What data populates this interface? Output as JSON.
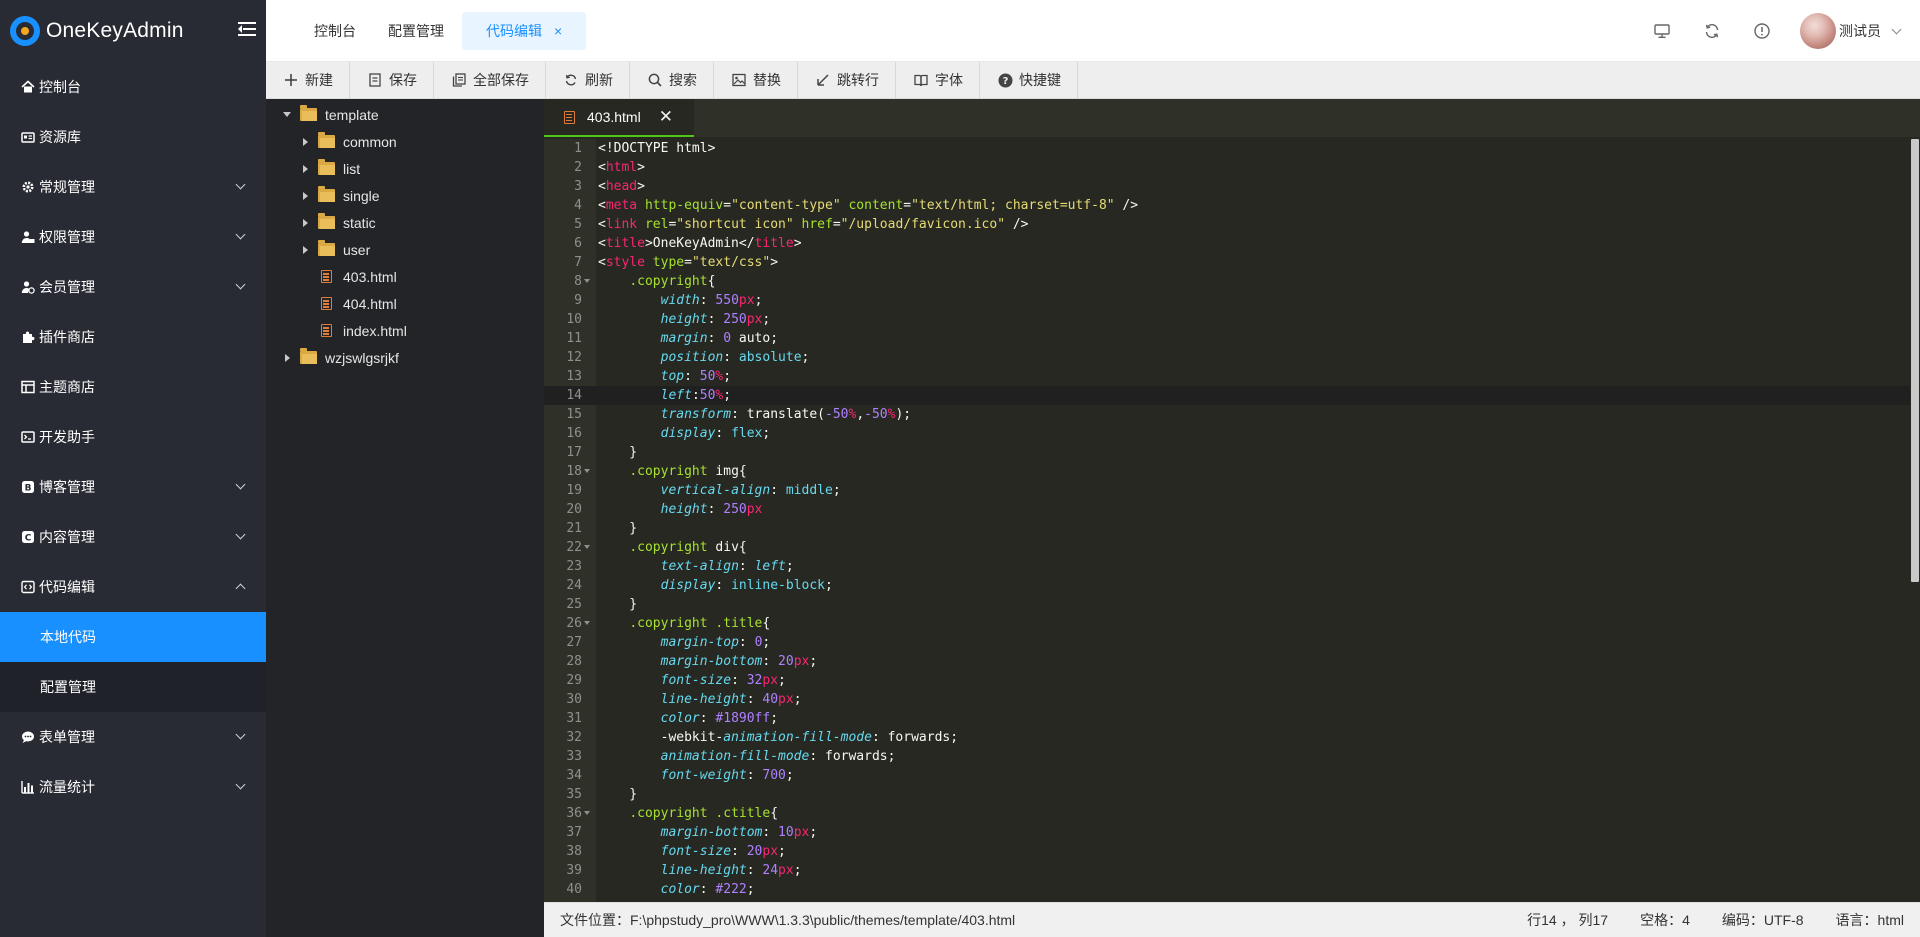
{
  "app": {
    "title": "OneKeyAdmin"
  },
  "sidebar": {
    "items": [
      {
        "label": "控制台",
        "icon": "home-icon"
      },
      {
        "label": "资源库",
        "icon": "library-icon"
      },
      {
        "label": "常规管理",
        "icon": "gear-icon",
        "expandable": true
      },
      {
        "label": "权限管理",
        "icon": "user-lock-icon",
        "expandable": true
      },
      {
        "label": "会员管理",
        "icon": "member-icon",
        "expandable": true
      },
      {
        "label": "插件商店",
        "icon": "puzzle-icon"
      },
      {
        "label": "主题商店",
        "icon": "layout-icon"
      },
      {
        "label": "开发助手",
        "icon": "terminal-icon"
      },
      {
        "label": "博客管理",
        "icon": "blog-icon",
        "expandable": true
      },
      {
        "label": "内容管理",
        "icon": "content-icon",
        "expandable": true
      },
      {
        "label": "代码编辑",
        "icon": "code-icon",
        "expandable": true,
        "expanded": true
      },
      {
        "label": "表单管理",
        "icon": "chat-icon",
        "expandable": true
      },
      {
        "label": "流量统计",
        "icon": "bar-chart-icon",
        "expandable": true
      }
    ],
    "code_submenu": [
      {
        "label": "本地代码",
        "active": true
      },
      {
        "label": "配置管理",
        "active": false
      }
    ]
  },
  "header": {
    "tabs": [
      {
        "label": "控制台"
      },
      {
        "label": "配置管理"
      },
      {
        "label": "代码编辑",
        "active": true,
        "close": "×"
      }
    ],
    "user": {
      "name": "测试员"
    }
  },
  "toolbar": {
    "buttons": [
      {
        "label": "新建",
        "icon": "plus-icon"
      },
      {
        "label": "保存",
        "icon": "save-icon"
      },
      {
        "label": "全部保存",
        "icon": "save-all-icon"
      },
      {
        "label": "刷新",
        "icon": "refresh-icon"
      },
      {
        "label": "搜索",
        "icon": "search-icon"
      },
      {
        "label": "替换",
        "icon": "replace-icon"
      },
      {
        "label": "跳转行",
        "icon": "goto-line-icon"
      },
      {
        "label": "字体",
        "icon": "font-icon"
      },
      {
        "label": "快捷键",
        "icon": "help-icon"
      }
    ]
  },
  "tree": {
    "nodes": [
      {
        "label": "template",
        "type": "folder",
        "open": true,
        "depth": 0
      },
      {
        "label": "common",
        "type": "folder",
        "open": false,
        "depth": 1
      },
      {
        "label": "list",
        "type": "folder",
        "open": false,
        "depth": 1
      },
      {
        "label": "single",
        "type": "folder",
        "open": false,
        "depth": 1
      },
      {
        "label": "static",
        "type": "folder",
        "open": false,
        "depth": 1
      },
      {
        "label": "user",
        "type": "folder",
        "open": false,
        "depth": 1
      },
      {
        "label": "403.html",
        "type": "html",
        "depth": 1
      },
      {
        "label": "404.html",
        "type": "html",
        "depth": 1
      },
      {
        "label": "index.html",
        "type": "html",
        "depth": 1
      },
      {
        "label": "wzjswlgsrjkf",
        "type": "folder",
        "open": false,
        "depth": 0
      }
    ]
  },
  "editor": {
    "tab": {
      "label": "403.html",
      "close": "✕"
    },
    "highlight_line": 14,
    "lines": [
      [
        [
          "<!DOCTYPE html>",
          "plain"
        ]
      ],
      [
        [
          "<",
          "plain"
        ],
        [
          "html",
          "tag"
        ],
        [
          ">",
          "plain"
        ]
      ],
      [
        [
          "<",
          "plain"
        ],
        [
          "head",
          "tag"
        ],
        [
          ">",
          "plain"
        ]
      ],
      [
        [
          "<",
          "plain"
        ],
        [
          "meta",
          "tag"
        ],
        [
          " ",
          "plain"
        ],
        [
          "http-equiv",
          "attr"
        ],
        [
          "=",
          "plain"
        ],
        [
          "\"content-type\"",
          "str"
        ],
        [
          " ",
          "plain"
        ],
        [
          "content",
          "attr"
        ],
        [
          "=",
          "plain"
        ],
        [
          "\"text/html; charset=utf-8\"",
          "str"
        ],
        [
          " />",
          "plain"
        ]
      ],
      [
        [
          "<",
          "plain"
        ],
        [
          "link",
          "tag"
        ],
        [
          " ",
          "plain"
        ],
        [
          "rel",
          "attr"
        ],
        [
          "=",
          "plain"
        ],
        [
          "\"shortcut icon\"",
          "str"
        ],
        [
          " ",
          "plain"
        ],
        [
          "href",
          "attr"
        ],
        [
          "=",
          "plain"
        ],
        [
          "\"/upload/favicon.ico\"",
          "str"
        ],
        [
          " />",
          "plain"
        ]
      ],
      [
        [
          "<",
          "plain"
        ],
        [
          "title",
          "tag"
        ],
        [
          ">OneKeyAdmin</",
          "plain"
        ],
        [
          "title",
          "tag"
        ],
        [
          ">",
          "plain"
        ]
      ],
      [
        [
          "<",
          "plain"
        ],
        [
          "style",
          "tag"
        ],
        [
          " ",
          "plain"
        ],
        [
          "type",
          "attr"
        ],
        [
          "=",
          "plain"
        ],
        [
          "\"text/css\"",
          "str"
        ],
        [
          ">",
          "plain"
        ]
      ],
      [
        [
          "    ",
          "plain"
        ],
        [
          ".copyright",
          "sel"
        ],
        [
          "{",
          "plain"
        ]
      ],
      [
        [
          "        ",
          "plain"
        ],
        [
          "width",
          "prop"
        ],
        [
          ": ",
          "plain"
        ],
        [
          "550",
          "num"
        ],
        [
          "px",
          "unit"
        ],
        [
          ";",
          "plain"
        ]
      ],
      [
        [
          "        ",
          "plain"
        ],
        [
          "height",
          "prop"
        ],
        [
          ": ",
          "plain"
        ],
        [
          "250",
          "num"
        ],
        [
          "px",
          "unit"
        ],
        [
          ";",
          "plain"
        ]
      ],
      [
        [
          "        ",
          "plain"
        ],
        [
          "margin",
          "prop"
        ],
        [
          ": ",
          "plain"
        ],
        [
          "0",
          "num"
        ],
        [
          " auto;",
          "plain"
        ]
      ],
      [
        [
          "        ",
          "plain"
        ],
        [
          "position",
          "prop"
        ],
        [
          ": ",
          "plain"
        ],
        [
          "absolute",
          "val"
        ],
        [
          ";",
          "plain"
        ]
      ],
      [
        [
          "        ",
          "plain"
        ],
        [
          "top",
          "prop"
        ],
        [
          ": ",
          "plain"
        ],
        [
          "50",
          "num"
        ],
        [
          "%",
          "unit"
        ],
        [
          ";",
          "plain"
        ]
      ],
      [
        [
          "        ",
          "plain"
        ],
        [
          "left",
          "prop"
        ],
        [
          ":",
          "plain"
        ],
        [
          "50",
          "num"
        ],
        [
          "%",
          "unit"
        ],
        [
          ";",
          "plain"
        ]
      ],
      [
        [
          "        ",
          "plain"
        ],
        [
          "transform",
          "prop"
        ],
        [
          ": translate(",
          "plain"
        ],
        [
          "-50",
          "num"
        ],
        [
          "%",
          "unit"
        ],
        [
          ",",
          "plain"
        ],
        [
          "-50",
          "num"
        ],
        [
          "%",
          "unit"
        ],
        [
          ");",
          "plain"
        ]
      ],
      [
        [
          "        ",
          "plain"
        ],
        [
          "display",
          "prop"
        ],
        [
          ": ",
          "plain"
        ],
        [
          "flex",
          "val"
        ],
        [
          ";",
          "plain"
        ]
      ],
      [
        [
          "    }",
          "plain"
        ]
      ],
      [
        [
          "    ",
          "plain"
        ],
        [
          ".copyright",
          "sel"
        ],
        [
          " img{",
          "plain"
        ]
      ],
      [
        [
          "        ",
          "plain"
        ],
        [
          "vertical-align",
          "prop"
        ],
        [
          ": ",
          "plain"
        ],
        [
          "middle",
          "val"
        ],
        [
          ";",
          "plain"
        ]
      ],
      [
        [
          "        ",
          "plain"
        ],
        [
          "height",
          "prop"
        ],
        [
          ": ",
          "plain"
        ],
        [
          "250",
          "num"
        ],
        [
          "px",
          "unit"
        ]
      ],
      [
        [
          "    }",
          "plain"
        ]
      ],
      [
        [
          "    ",
          "plain"
        ],
        [
          ".copyright",
          "sel"
        ],
        [
          " div{",
          "plain"
        ]
      ],
      [
        [
          "        ",
          "plain"
        ],
        [
          "text-align",
          "prop"
        ],
        [
          ": ",
          "plain"
        ],
        [
          "left",
          "prop"
        ],
        [
          ";",
          "plain"
        ]
      ],
      [
        [
          "        ",
          "plain"
        ],
        [
          "display",
          "prop"
        ],
        [
          ": ",
          "plain"
        ],
        [
          "inline-block",
          "val"
        ],
        [
          ";",
          "plain"
        ]
      ],
      [
        [
          "    }",
          "plain"
        ]
      ],
      [
        [
          "    ",
          "plain"
        ],
        [
          ".copyright",
          "sel"
        ],
        [
          " ",
          "plain"
        ],
        [
          ".title",
          "sel"
        ],
        [
          "{",
          "plain"
        ]
      ],
      [
        [
          "        ",
          "plain"
        ],
        [
          "margin-top",
          "prop"
        ],
        [
          ": ",
          "plain"
        ],
        [
          "0",
          "num"
        ],
        [
          ";",
          "plain"
        ]
      ],
      [
        [
          "        ",
          "plain"
        ],
        [
          "margin-bottom",
          "prop"
        ],
        [
          ": ",
          "plain"
        ],
        [
          "20",
          "num"
        ],
        [
          "px",
          "unit"
        ],
        [
          ";",
          "plain"
        ]
      ],
      [
        [
          "        ",
          "plain"
        ],
        [
          "font-size",
          "prop"
        ],
        [
          ": ",
          "plain"
        ],
        [
          "32",
          "num"
        ],
        [
          "px",
          "unit"
        ],
        [
          ";",
          "plain"
        ]
      ],
      [
        [
          "        ",
          "plain"
        ],
        [
          "line-height",
          "prop"
        ],
        [
          ": ",
          "plain"
        ],
        [
          "40",
          "num"
        ],
        [
          "px",
          "unit"
        ],
        [
          ";",
          "plain"
        ]
      ],
      [
        [
          "        ",
          "plain"
        ],
        [
          "color",
          "prop"
        ],
        [
          ": ",
          "plain"
        ],
        [
          "#1890ff",
          "num"
        ],
        [
          ";",
          "plain"
        ]
      ],
      [
        [
          "        -webkit-",
          "plain"
        ],
        [
          "animation-fill-mode",
          "prop"
        ],
        [
          ": forwards;",
          "plain"
        ]
      ],
      [
        [
          "        ",
          "plain"
        ],
        [
          "animation-fill-mode",
          "prop"
        ],
        [
          ": forwards;",
          "plain"
        ]
      ],
      [
        [
          "        ",
          "plain"
        ],
        [
          "font-weight",
          "prop"
        ],
        [
          ": ",
          "plain"
        ],
        [
          "700",
          "num"
        ],
        [
          ";",
          "plain"
        ]
      ],
      [
        [
          "    }",
          "plain"
        ]
      ],
      [
        [
          "    ",
          "plain"
        ],
        [
          ".copyright",
          "sel"
        ],
        [
          " ",
          "plain"
        ],
        [
          ".ctitle",
          "sel"
        ],
        [
          "{",
          "plain"
        ]
      ],
      [
        [
          "        ",
          "plain"
        ],
        [
          "margin-bottom",
          "prop"
        ],
        [
          ": ",
          "plain"
        ],
        [
          "10",
          "num"
        ],
        [
          "px",
          "unit"
        ],
        [
          ";",
          "plain"
        ]
      ],
      [
        [
          "        ",
          "plain"
        ],
        [
          "font-size",
          "prop"
        ],
        [
          ": ",
          "plain"
        ],
        [
          "20",
          "num"
        ],
        [
          "px",
          "unit"
        ],
        [
          ";",
          "plain"
        ]
      ],
      [
        [
          "        ",
          "plain"
        ],
        [
          "line-height",
          "prop"
        ],
        [
          ": ",
          "plain"
        ],
        [
          "24",
          "num"
        ],
        [
          "px",
          "unit"
        ],
        [
          ";",
          "plain"
        ]
      ],
      [
        [
          "        ",
          "plain"
        ],
        [
          "color",
          "prop"
        ],
        [
          ": ",
          "plain"
        ],
        [
          "#222",
          "num"
        ],
        [
          ";",
          "plain"
        ]
      ]
    ],
    "fold_lines": [
      8,
      18,
      22,
      26,
      36
    ]
  },
  "status": {
    "path": "文件位置：F:\\phpstudy_pro\\WWW\\1.3.3\\public/themes/template/403.html",
    "cursor": "行14 ， 列17",
    "spaces": "空格：4",
    "encoding": "编码：UTF-8",
    "language": "语言：html"
  },
  "colors": {
    "accent": "#1890ff",
    "sidebar_bg": "#282b33",
    "editor_bg": "#272822",
    "tree_bg": "#222427"
  }
}
